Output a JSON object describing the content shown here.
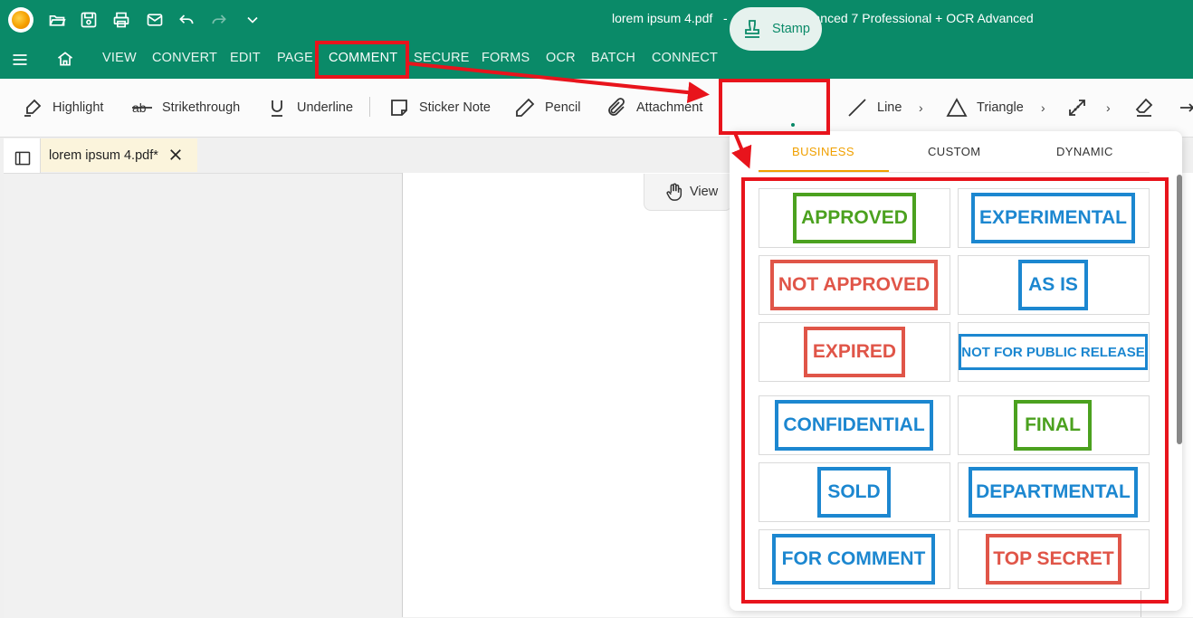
{
  "titlebar": {
    "title": "lorem ipsum 4.pdf   -   PDFsam Enhanced 7 Professional + OCR Advanced",
    "icons": [
      "app-logo",
      "open-folder-icon",
      "save-icon",
      "print-icon",
      "mail-icon",
      "undo-icon",
      "redo-icon",
      "chevron-down-icon"
    ]
  },
  "menu": {
    "items": [
      "VIEW",
      "CONVERT",
      "EDIT",
      "PAGE",
      "COMMENT",
      "SECURE",
      "FORMS",
      "OCR",
      "BATCH",
      "CONNECT"
    ],
    "active": "COMMENT"
  },
  "ribbon": {
    "highlight": "Highlight",
    "strikethrough": "Strikethrough",
    "underline": "Underline",
    "sticker_note": "Sticker Note",
    "pencil": "Pencil",
    "attachment": "Attachment",
    "stamp": "Stamp",
    "line": "Line",
    "triangle": "Triangle"
  },
  "doc_tab": {
    "label": "lorem ipsum 4.pdf*"
  },
  "view_button": {
    "label": "View"
  },
  "stamp_popup": {
    "tabs": [
      "BUSINESS",
      "CUSTOM",
      "DYNAMIC"
    ],
    "active_tab": "BUSINESS",
    "stamps": [
      {
        "label": "APPROVED",
        "color": "#4ba11f"
      },
      {
        "label": "EXPERIMENTAL",
        "color": "#1c87d0"
      },
      {
        "label": "NOT APPROVED",
        "color": "#e05548"
      },
      {
        "label": "AS IS",
        "color": "#1c87d0"
      },
      {
        "label": "EXPIRED",
        "color": "#e05548"
      },
      {
        "label": "NOT FOR PUBLIC RELEASE",
        "color": "#1c87d0"
      },
      {
        "label": "CONFIDENTIAL",
        "color": "#1c87d0"
      },
      {
        "label": "FINAL",
        "color": "#4ba11f"
      },
      {
        "label": "SOLD",
        "color": "#1c87d0"
      },
      {
        "label": "DEPARTMENTAL",
        "color": "#1c87d0"
      },
      {
        "label": "FOR COMMENT",
        "color": "#1c87d0"
      },
      {
        "label": "TOP SECRET",
        "color": "#e05548"
      }
    ]
  },
  "colors": {
    "brand": "#0a8a68",
    "annotation_red": "#e8141c",
    "tab_accent": "#f0a000"
  }
}
